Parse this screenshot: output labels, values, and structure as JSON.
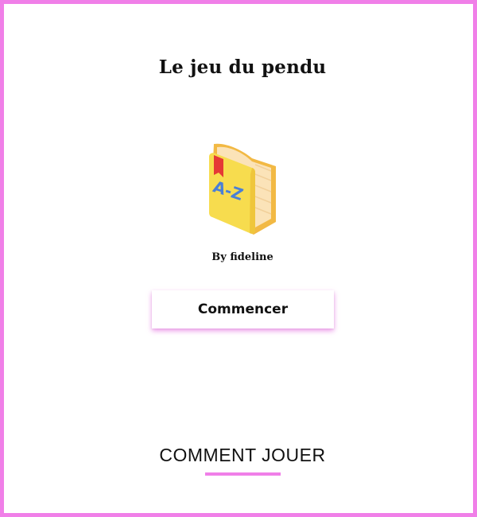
{
  "header": {
    "title": "Le jeu du pendu"
  },
  "logo": {
    "icon": "dictionary-book-icon",
    "text": "A-Z"
  },
  "byline": "By fideline",
  "start_button": {
    "label": "Commencer"
  },
  "how_to_play": {
    "label": "COMMENT JOUER"
  },
  "colors": {
    "accent": "#f07fe8",
    "book_cover": "#f7dc4e",
    "book_pages": "#fbe3b8",
    "book_spine": "#f2b944",
    "bookmark": "#e53935",
    "book_letters": "#4a7fd6"
  }
}
